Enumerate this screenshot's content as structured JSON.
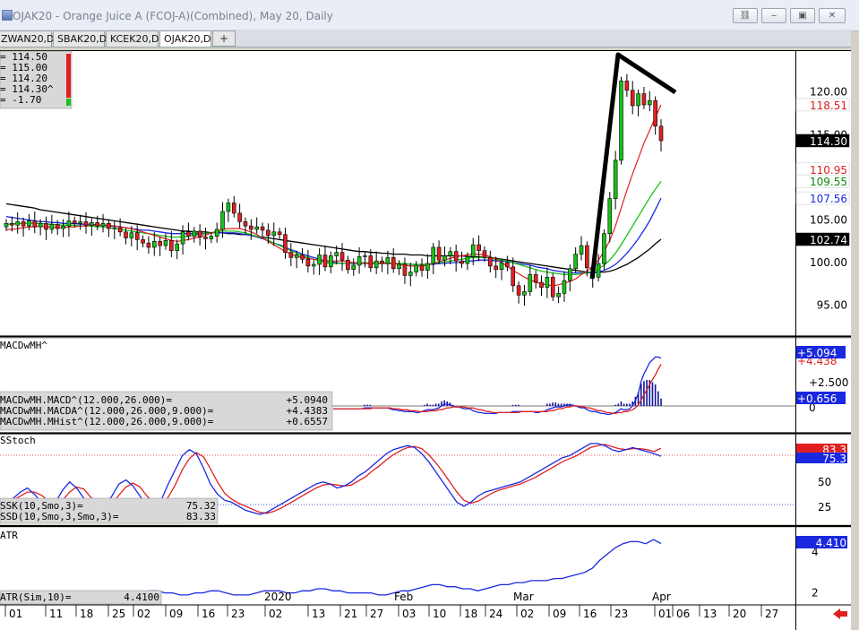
{
  "window": {
    "title": "OJAK20 - Orange Juice A (FCOJ-A)(Combined), May 20, Daily",
    "buttons": [
      {
        "name": "link-icon",
        "glyph": "⛓"
      },
      {
        "name": "minimize-icon",
        "glyph": "‒"
      },
      {
        "name": "restore-icon",
        "glyph": "▣"
      },
      {
        "name": "close-icon",
        "glyph": "✕"
      }
    ]
  },
  "tabs": [
    {
      "label": "ZWAN20,D",
      "active": false
    },
    {
      "label": "SBAK20,D",
      "active": false
    },
    {
      "label": "KCEK20,D",
      "active": false
    },
    {
      "label": "OJAK20,D",
      "active": true
    }
  ],
  "tab_add_label": "+",
  "ohlc_box": {
    "lines": [
      "= 114.50",
      "= 115.00",
      "= 114.20",
      "= 114.30^",
      "= -1.70"
    ]
  },
  "price_panel": {
    "y_ticks": [
      "120.00",
      "115.00",
      "105.00",
      "100.00",
      "95.00"
    ],
    "y_tick_values": [
      120,
      115,
      105,
      100,
      95
    ],
    "ylim": [
      91.5,
      124.8
    ],
    "badges": [
      {
        "label": "118.51",
        "value": 118.51,
        "bg": "#ffffff",
        "fg": "#e02020"
      },
      {
        "label": "114.30",
        "value": 114.3,
        "bg": "#000000",
        "fg": "#ffffff"
      },
      {
        "label": "110.95",
        "value": 110.95,
        "bg": "#ffffff",
        "fg": "#e02020"
      },
      {
        "label": "109.55",
        "value": 109.55,
        "bg": "#ffffff",
        "fg": "#0a8a0a"
      },
      {
        "label": "107.56",
        "value": 107.56,
        "bg": "#ffffff",
        "fg": "#1a28e0"
      },
      {
        "label": "102.74",
        "value": 102.74,
        "bg": "#000000",
        "fg": "#ffffff"
      }
    ]
  },
  "macd_panel": {
    "title": "MACDwMH^",
    "legend": [
      {
        "label": "MACDwMH.MACD^(12.000,26.000)=",
        "value": "+5.0940"
      },
      {
        "label": "MACDwMH.MACDA^(12.000,26.000,9.000)=",
        "value": "+4.4383"
      },
      {
        "label": "MACDwMH.MHist^(12.000,26.000,9.000)=",
        "value": "+0.6557"
      }
    ],
    "y_ticks": [
      "+2.500",
      "0"
    ],
    "badges": [
      {
        "label": "+5.094",
        "bg": "#1a28e0",
        "fg": "#ffffff"
      },
      {
        "label": "+4.438",
        "bg": "#ffffff",
        "fg": "#e02020"
      },
      {
        "label": "+0.656",
        "bg": "#1a28e0",
        "fg": "#ffffff"
      }
    ]
  },
  "stoch_panel": {
    "title": "SStoch",
    "legend": [
      {
        "label": "SSK(10,Smo,3)=",
        "value": "75.32"
      },
      {
        "label": "SSD(10,Smo,3,Smo,3)=",
        "value": "83.33"
      }
    ],
    "y_ticks": [
      "50",
      "25"
    ],
    "badges": [
      {
        "label": "83.3",
        "bg": "#e02020",
        "fg": "#ffffff"
      },
      {
        "label": "75.3",
        "bg": "#1a28e0",
        "fg": "#ffffff"
      }
    ]
  },
  "atr_panel": {
    "title": "ATR",
    "legend": [
      {
        "label": "ATR(Sim,10)=",
        "value": "4.4100"
      }
    ],
    "y_ticks": [
      "4",
      "2"
    ],
    "badges": [
      {
        "label": "4.410",
        "bg": "#1a28e0",
        "fg": "#ffffff"
      }
    ]
  },
  "x_axis": {
    "labels": [
      "01",
      "11",
      "18",
      "25",
      "02",
      "09",
      "16",
      "23",
      "02",
      "13",
      "21",
      "27",
      "03",
      "10",
      "18",
      "24",
      "02",
      "09",
      "16",
      "23",
      "01",
      "06",
      "13",
      "20",
      "27"
    ],
    "month_labels": [
      "2020",
      "Feb",
      "Mar",
      "Apr"
    ]
  },
  "chart_data": {
    "type": "candlestick",
    "title": "OJAK20 - Orange Juice A (FCOJ-A)(Combined), May 20, Daily",
    "ylim": [
      91.5,
      124.8
    ],
    "last": {
      "open": 114.5,
      "high": 115.0,
      "low": 114.2,
      "close": 114.3,
      "change": -1.7
    },
    "close": [
      104.6,
      104.4,
      104.8,
      104.3,
      104.9,
      104.2,
      104.6,
      103.9,
      104.5,
      104.0,
      104.3,
      104.9,
      104.6,
      104.8,
      104.4,
      104.7,
      104.3,
      104.6,
      104.0,
      104.1,
      103.6,
      102.9,
      103.5,
      102.7,
      102.3,
      101.8,
      102.5,
      102.0,
      102.6,
      101.4,
      102.2,
      103.6,
      103.1,
      103.7,
      103.0,
      102.8,
      103.1,
      103.9,
      106.0,
      107.0,
      105.8,
      104.8,
      104.3,
      103.9,
      104.2,
      103.8,
      103.2,
      103.6,
      103.3,
      101.2,
      100.6,
      100.9,
      100.4,
      99.6,
      99.8,
      100.9,
      99.5,
      100.8,
      101.2,
      100.3,
      99.2,
      99.7,
      100.7,
      100.8,
      99.4,
      100.2,
      99.9,
      100.6,
      99.3,
      99.8,
      98.5,
      98.9,
      99.7,
      99.1,
      99.9,
      101.8,
      100.3,
      100.8,
      101.3,
      100.2,
      99.9,
      100.7,
      102.1,
      101.4,
      100.6,
      99.6,
      99.2,
      100.0,
      99.5,
      97.3,
      96.2,
      96.6,
      98.6,
      97.7,
      97.1,
      98.3,
      96.0,
      96.4,
      97.9,
      99.3,
      101.0,
      102.0,
      99.4,
      98.3,
      99.9,
      103.4,
      107.5,
      112.0,
      121.3,
      120.2,
      118.4,
      119.8,
      118.5,
      119.0,
      116.0,
      114.3
    ],
    "sma_red": [
      103.9,
      103.9,
      104.0,
      104.1,
      104.2,
      104.2,
      104.3,
      104.2,
      104.2,
      104.1,
      104.1,
      104.2,
      104.2,
      104.3,
      104.3,
      104.4,
      104.4,
      104.4,
      104.4,
      104.3,
      104.2,
      104.1,
      104.0,
      103.8,
      103.6,
      103.4,
      103.2,
      103.0,
      102.8,
      102.6,
      102.5,
      102.6,
      102.7,
      102.9,
      103.0,
      103.2,
      103.5,
      103.7,
      103.9,
      104.0,
      104.0,
      104.0,
      103.8,
      103.6,
      103.3,
      102.9,
      102.5,
      102.1,
      101.7,
      101.3,
      101.0,
      100.8,
      100.6,
      100.5,
      100.4,
      100.3,
      100.2,
      100.2,
      100.2,
      100.2,
      100.1,
      100.0,
      100.0,
      99.9,
      99.9,
      99.9,
      99.9,
      99.9,
      99.9,
      99.8,
      99.7,
      99.6,
      99.6,
      99.6,
      99.7,
      99.9,
      100.1,
      100.3,
      100.5,
      100.7,
      100.8,
      100.9,
      101.0,
      101.0,
      100.9,
      100.7,
      100.4,
      100.0,
      99.6,
      99.1,
      98.7,
      98.3,
      98.0,
      97.7,
      97.5,
      97.4,
      97.3,
      97.4,
      97.6,
      97.8,
      98.1,
      98.6,
      99.0,
      99.6,
      100.3,
      101.3,
      102.6,
      104.3,
      106.4,
      108.5,
      110.4,
      112.2,
      114.0,
      115.5,
      117.0,
      118.5
    ],
    "sma_green": [
      104.5,
      104.5,
      104.6,
      104.6,
      104.6,
      104.6,
      104.6,
      104.5,
      104.5,
      104.4,
      104.4,
      104.4,
      104.4,
      104.3,
      104.3,
      104.3,
      104.2,
      104.2,
      104.1,
      104.0,
      103.9,
      103.8,
      103.7,
      103.6,
      103.5,
      103.4,
      103.3,
      103.2,
      103.1,
      103.0,
      103.0,
      103.0,
      103.1,
      103.2,
      103.3,
      103.4,
      103.5,
      103.6,
      103.7,
      103.7,
      103.7,
      103.6,
      103.5,
      103.3,
      103.1,
      102.9,
      102.6,
      102.3,
      102.0,
      101.7,
      101.4,
      101.1,
      100.8,
      100.6,
      100.4,
      100.2,
      100.0,
      99.9,
      99.9,
      99.9,
      99.9,
      100.0,
      100.0,
      100.0,
      100.0,
      100.0,
      100.0,
      100.0,
      99.9,
      99.9,
      99.9,
      99.8,
      99.8,
      99.8,
      99.8,
      99.9,
      100.0,
      100.1,
      100.2,
      100.3,
      100.4,
      100.5,
      100.6,
      100.6,
      100.6,
      100.5,
      100.4,
      100.3,
      100.2,
      100.0,
      99.8,
      99.6,
      99.4,
      99.2,
      99.0,
      98.9,
      98.8,
      98.7,
      98.6,
      98.6,
      98.6,
      98.7,
      98.8,
      99.0,
      99.3,
      99.7,
      100.3,
      101.1,
      102.1,
      103.2,
      104.3,
      105.4,
      106.5,
      107.6,
      108.6,
      109.55
    ],
    "sma_blue": [
      105.4,
      105.3,
      105.2,
      105.1,
      105.0,
      104.9,
      104.8,
      104.8,
      104.7,
      104.7,
      104.6,
      104.6,
      104.6,
      104.5,
      104.5,
      104.5,
      104.4,
      104.4,
      104.3,
      104.3,
      104.2,
      104.1,
      104.0,
      103.9,
      103.8,
      103.8,
      103.7,
      103.6,
      103.5,
      103.4,
      103.4,
      103.4,
      103.4,
      103.4,
      103.4,
      103.4,
      103.5,
      103.5,
      103.5,
      103.5,
      103.5,
      103.4,
      103.3,
      103.2,
      103.0,
      102.8,
      102.6,
      102.3,
      102.1,
      101.8,
      101.5,
      101.3,
      101.0,
      100.8,
      100.6,
      100.4,
      100.2,
      100.1,
      100.0,
      99.9,
      99.9,
      99.9,
      99.9,
      99.9,
      99.9,
      99.9,
      99.9,
      99.9,
      99.9,
      99.9,
      99.9,
      99.8,
      99.8,
      99.8,
      99.8,
      99.8,
      99.9,
      99.9,
      100.0,
      100.0,
      100.1,
      100.2,
      100.2,
      100.3,
      100.3,
      100.3,
      100.2,
      100.2,
      100.1,
      100.0,
      99.9,
      99.8,
      99.7,
      99.5,
      99.4,
      99.3,
      99.1,
      99.0,
      98.9,
      98.8,
      98.8,
      98.8,
      98.8,
      98.8,
      98.9,
      99.1,
      99.4,
      99.8,
      100.4,
      101.1,
      101.9,
      102.8,
      103.8,
      104.9,
      106.2,
      107.56
    ],
    "sma_black": [
      106.9,
      106.8,
      106.7,
      106.6,
      106.5,
      106.4,
      106.2,
      106.1,
      106.0,
      105.9,
      105.8,
      105.7,
      105.6,
      105.5,
      105.4,
      105.3,
      105.2,
      105.1,
      105.0,
      104.9,
      104.8,
      104.7,
      104.6,
      104.5,
      104.4,
      104.3,
      104.2,
      104.1,
      104.0,
      103.9,
      103.8,
      103.7,
      103.7,
      103.6,
      103.6,
      103.6,
      103.5,
      103.5,
      103.5,
      103.4,
      103.4,
      103.3,
      103.3,
      103.2,
      103.1,
      103.0,
      102.9,
      102.8,
      102.7,
      102.6,
      102.5,
      102.4,
      102.3,
      102.2,
      102.1,
      102.0,
      101.9,
      101.8,
      101.7,
      101.6,
      101.5,
      101.4,
      101.3,
      101.3,
      101.2,
      101.2,
      101.1,
      101.1,
      101.0,
      101.0,
      101.0,
      100.9,
      100.9,
      100.9,
      100.8,
      100.8,
      100.8,
      100.8,
      100.8,
      100.8,
      100.8,
      100.7,
      100.7,
      100.7,
      100.6,
      100.6,
      100.5,
      100.4,
      100.3,
      100.2,
      100.1,
      100.0,
      99.9,
      99.8,
      99.7,
      99.6,
      99.5,
      99.4,
      99.3,
      99.2,
      99.1,
      99.0,
      98.9,
      98.9,
      98.9,
      98.9,
      99.0,
      99.2,
      99.5,
      99.8,
      100.2,
      100.6,
      101.1,
      101.6,
      102.2,
      102.74
    ],
    "macd_line": [
      -0.3,
      -0.3,
      -0.3,
      -0.3,
      -0.3,
      -0.3,
      -0.3,
      -0.3,
      -0.3,
      -0.3,
      -0.3,
      -0.2,
      -0.2,
      -0.2,
      -0.2,
      -0.2,
      -0.2,
      -0.2,
      -0.2,
      -0.2,
      -0.3,
      -0.4,
      -0.4,
      -0.5,
      -0.5,
      -0.6,
      -0.6,
      -0.6,
      -0.6,
      -0.7,
      -0.7,
      -0.6,
      -0.5,
      -0.4,
      -0.4,
      -0.4,
      -0.3,
      -0.2,
      0.0,
      0.2,
      0.2,
      0.1,
      0.0,
      -0.1,
      -0.1,
      -0.2,
      -0.3,
      -0.3,
      -0.3,
      -0.5,
      -0.6,
      -0.7,
      -0.7,
      -0.8,
      -0.8,
      -0.8,
      -0.8,
      -0.8,
      -0.7,
      -0.7,
      -0.7,
      -0.7,
      -0.7,
      -0.6,
      -0.6,
      -0.6,
      -0.6,
      -0.6,
      -0.6,
      -0.6,
      -0.6,
      -0.7,
      -0.7,
      -0.6,
      -0.6,
      -0.4,
      -0.3,
      -0.2,
      -0.1,
      -0.1,
      -0.1,
      0.0,
      0.1,
      0.1,
      0.1,
      0.0,
      -0.1,
      -0.2,
      -0.2,
      -0.4,
      -0.5,
      -0.6,
      -0.6,
      -0.7,
      -0.8,
      -0.8,
      -0.9,
      -0.9,
      -0.8,
      -0.7,
      -0.5,
      -0.3,
      -0.4,
      -0.4,
      -0.3,
      0.0,
      0.6,
      1.3,
      2.6,
      3.4,
      4.0,
      4.6,
      4.9,
      5.2,
      5.2,
      5.094
    ],
    "macd_avg": [
      -0.3,
      -0.3,
      -0.3,
      -0.3,
      -0.3,
      -0.3,
      -0.3,
      -0.3,
      -0.3,
      -0.3,
      -0.3,
      -0.3,
      -0.3,
      -0.3,
      -0.2,
      -0.2,
      -0.2,
      -0.2,
      -0.2,
      -0.2,
      -0.2,
      -0.3,
      -0.3,
      -0.3,
      -0.4,
      -0.4,
      -0.4,
      -0.5,
      -0.5,
      -0.5,
      -0.6,
      -0.6,
      -0.6,
      -0.6,
      -0.5,
      -0.5,
      -0.5,
      -0.4,
      -0.4,
      -0.3,
      -0.2,
      -0.2,
      -0.1,
      -0.1,
      -0.1,
      -0.1,
      -0.1,
      -0.2,
      -0.2,
      -0.2,
      -0.3,
      -0.4,
      -0.4,
      -0.5,
      -0.6,
      -0.6,
      -0.7,
      -0.7,
      -0.7,
      -0.7,
      -0.7,
      -0.7,
      -0.7,
      -0.7,
      -0.7,
      -0.7,
      -0.6,
      -0.6,
      -0.6,
      -0.6,
      -0.6,
      -0.6,
      -0.6,
      -0.6,
      -0.6,
      -0.6,
      -0.5,
      -0.5,
      -0.4,
      -0.3,
      -0.3,
      -0.2,
      -0.1,
      -0.1,
      0.0,
      0.0,
      0.0,
      -0.1,
      -0.1,
      -0.2,
      -0.2,
      -0.3,
      -0.4,
      -0.5,
      -0.5,
      -0.6,
      -0.7,
      -0.7,
      -0.8,
      -0.8,
      -0.7,
      -0.7,
      -0.6,
      -0.6,
      -0.5,
      -0.4,
      -0.2,
      0.1,
      0.6,
      1.2,
      1.7,
      2.3,
      2.8,
      3.3,
      3.9,
      4.4383
    ],
    "macd_hist": [
      0,
      0,
      0,
      0,
      0,
      0,
      0,
      0,
      0,
      0,
      0,
      0.1,
      0.1,
      0.1,
      0,
      0,
      0,
      0,
      0,
      0,
      -0.1,
      -0.1,
      -0.1,
      -0.2,
      -0.1,
      -0.2,
      -0.2,
      -0.1,
      -0.1,
      -0.2,
      -0.1,
      0,
      0.1,
      0.2,
      0.1,
      0.1,
      0.2,
      0.2,
      0.4,
      0.5,
      0.4,
      0.3,
      0.1,
      0,
      0,
      -0.1,
      -0.2,
      -0.1,
      -0.1,
      -0.3,
      -0.3,
      -0.3,
      -0.3,
      -0.3,
      -0.2,
      -0.2,
      -0.1,
      -0.1,
      0,
      0,
      0,
      0,
      0,
      0.1,
      0.1,
      0.1,
      0,
      0,
      0,
      0,
      0,
      -0.1,
      -0.1,
      0,
      0,
      0.2,
      0.2,
      0.3,
      0.3,
      0.2,
      0.2,
      0.2,
      0.2,
      0.2,
      0.1,
      0,
      -0.1,
      -0.1,
      -0.1,
      -0.2,
      -0.1,
      -0.1,
      -0.2,
      -0.2,
      -0.3,
      -0.2,
      -0.2,
      -0.2,
      0,
      0.1,
      0.2,
      0.4,
      0.2,
      0.2,
      0.2,
      0.4,
      0.8,
      1.2,
      2.0,
      2.2,
      2.3,
      2.3,
      2.1,
      1.9,
      1.3,
      0.6557
    ],
    "stoch_k": [
      28,
      34,
      40,
      44,
      38,
      30,
      24,
      30,
      42,
      50,
      44,
      34,
      26,
      22,
      26,
      36,
      48,
      52,
      46,
      36,
      26,
      24,
      32,
      48,
      62,
      76,
      82,
      78,
      64,
      48,
      38,
      32,
      30,
      26,
      22,
      20,
      18,
      20,
      24,
      28,
      32,
      36,
      40,
      44,
      48,
      50,
      48,
      44,
      46,
      50,
      56,
      60,
      66,
      72,
      78,
      82,
      84,
      86,
      84,
      78,
      70,
      60,
      50,
      40,
      30,
      26,
      30,
      36,
      40,
      42,
      44,
      46,
      48,
      50,
      54,
      58,
      62,
      66,
      70,
      74,
      76,
      80,
      84,
      88,
      88,
      86,
      82,
      80,
      82,
      84,
      82,
      80,
      78,
      75.32
    ],
    "stoch_d": [
      30,
      32,
      36,
      40,
      40,
      37,
      31,
      28,
      32,
      40,
      45,
      43,
      35,
      27,
      25,
      28,
      37,
      45,
      49,
      45,
      36,
      29,
      27,
      35,
      47,
      62,
      73,
      79,
      75,
      63,
      50,
      39,
      33,
      29,
      26,
      23,
      20,
      19,
      21,
      24,
      28,
      32,
      36,
      40,
      44,
      47,
      48,
      47,
      46,
      47,
      51,
      55,
      61,
      66,
      72,
      77,
      81,
      84,
      85,
      83,
      77,
      69,
      60,
      50,
      40,
      32,
      29,
      31,
      35,
      39,
      42,
      44,
      46,
      48,
      51,
      54,
      58,
      62,
      66,
      70,
      73,
      76,
      80,
      84,
      86,
      87,
      85,
      83,
      82,
      83,
      83,
      82,
      80,
      83.33
    ],
    "atr": [
      2.0,
      2.0,
      2.1,
      2.1,
      2.0,
      2.0,
      1.9,
      1.9,
      2.0,
      2.0,
      2.1,
      2.1,
      2.0,
      1.9,
      1.9,
      1.9,
      2.0,
      2.1,
      2.1,
      2.1,
      2.0,
      2.0,
      2.1,
      2.1,
      2.2,
      2.2,
      2.1,
      2.1,
      2.0,
      2.0,
      2.0,
      2.0,
      1.9,
      1.9,
      2.0,
      2.1,
      2.1,
      2.2,
      2.3,
      2.4,
      2.4,
      2.3,
      2.3,
      2.2,
      2.2,
      2.1,
      2.2,
      2.3,
      2.4,
      2.4,
      2.5,
      2.5,
      2.6,
      2.6,
      2.6,
      2.7,
      2.7,
      2.8,
      2.9,
      3.0,
      3.2,
      3.6,
      3.9,
      4.2,
      4.4,
      4.5,
      4.5,
      4.4,
      4.6,
      4.41
    ]
  }
}
